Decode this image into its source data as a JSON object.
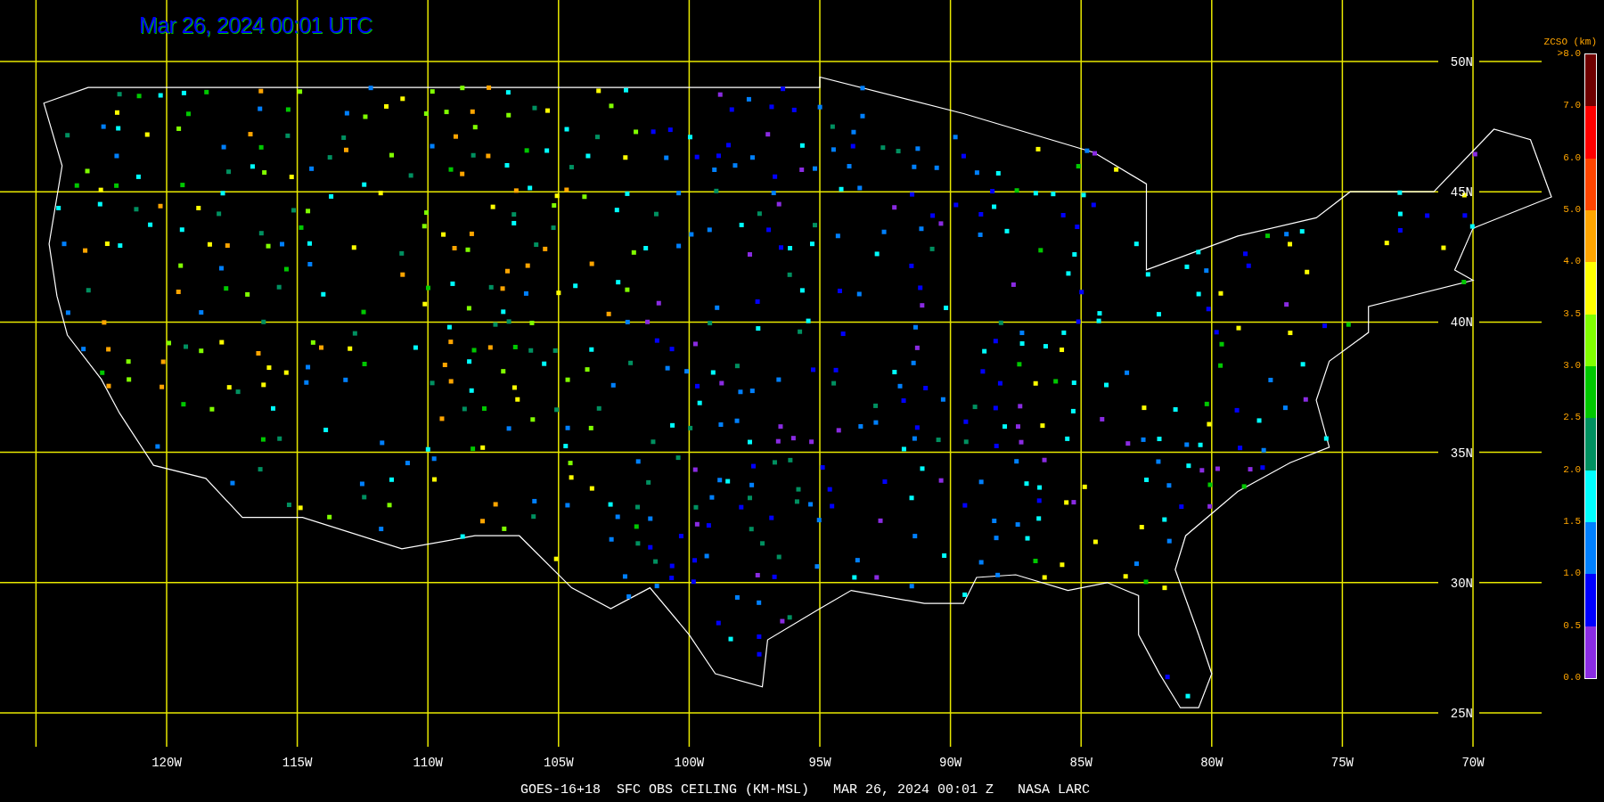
{
  "title": "Mar 26, 2024 00:01 UTC",
  "latitude_labels": [
    "50N",
    "45N",
    "40N",
    "35N",
    "30N",
    "25N"
  ],
  "longitude_labels": [
    "120W",
    "115W",
    "110W",
    "105W",
    "100W",
    "95W",
    "90W",
    "85W",
    "80W",
    "75W",
    "70W"
  ],
  "legend": {
    "title": "ZCSO (km)",
    "labels": [
      ">8.0",
      "7.0",
      "6.0",
      "5.0",
      "4.0",
      "3.5",
      "3.0",
      "2.5",
      "2.0",
      "1.5",
      "1.0",
      "0.5",
      "0.0"
    ],
    "segments": [
      {
        "color": "#6e0000"
      },
      {
        "color": "#ff0000"
      },
      {
        "color": "#ff4500"
      },
      {
        "color": "#ffa500"
      },
      {
        "color": "#ffff00"
      },
      {
        "color": "#80ff00"
      },
      {
        "color": "#00c800"
      },
      {
        "color": "#009060"
      },
      {
        "color": "#00ffff"
      },
      {
        "color": "#0080ff"
      },
      {
        "color": "#0000ff"
      },
      {
        "color": "#8a2be2"
      }
    ]
  },
  "footer": "GOES-16+18  SFC OBS CEILING (KM-MSL)   MAR 26, 2024 00:01 Z   NASA LARC"
}
